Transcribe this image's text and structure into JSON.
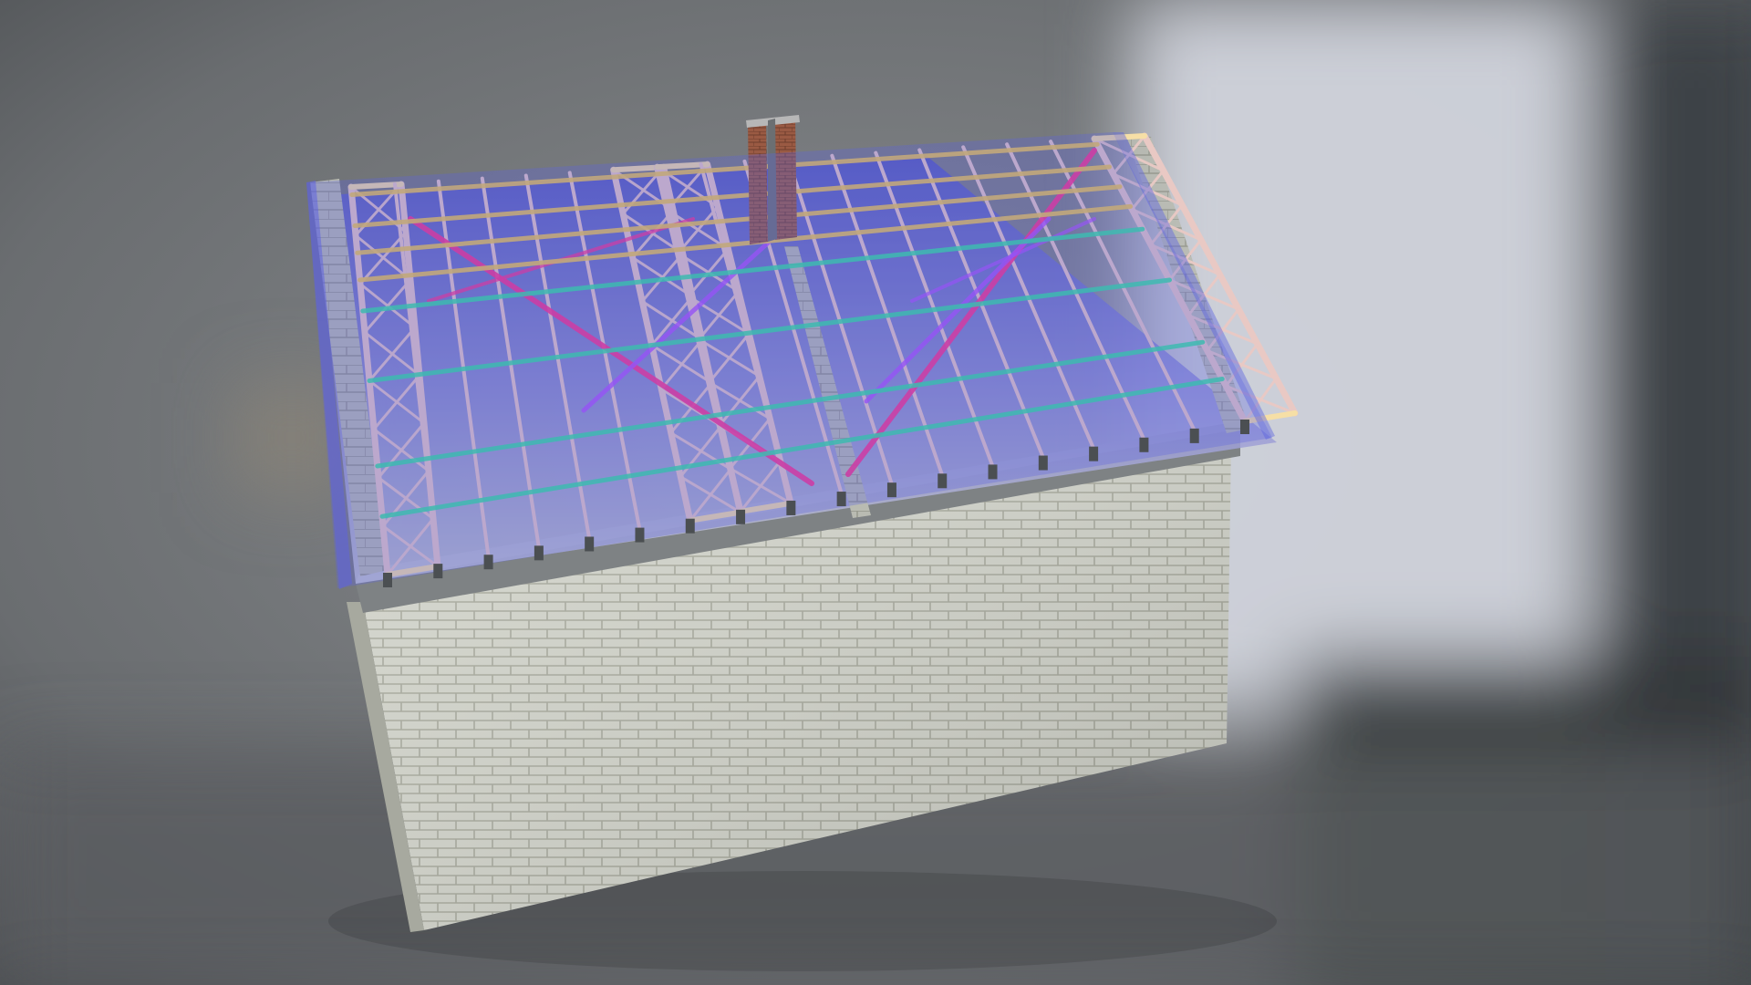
{
  "scene": {
    "subject": "3d-roof-truss-model",
    "colors": {
      "background_dark": "#3f4447",
      "background_mid": "#6f7173",
      "background_light": "#9a9ea3",
      "window_glow": "#cfd3dc",
      "brick_face": "#d3d5cc",
      "brick_mortar": "#a9ab9f",
      "brick_side": "#b9bbb2",
      "roof_glass": "#5e63e0",
      "truss_timber": "#e9c9c4",
      "truss_edge": "#f6dfa6",
      "purlin_yellow": "#f2c94c",
      "brace_pink": "#ff2d8a",
      "brace_violet": "#b04cff",
      "tie_green": "#2fe39a",
      "chimney_brick": "#9a5a43",
      "chimney_cap": "#b7b7b7",
      "wallplate": "#7e8284"
    }
  }
}
